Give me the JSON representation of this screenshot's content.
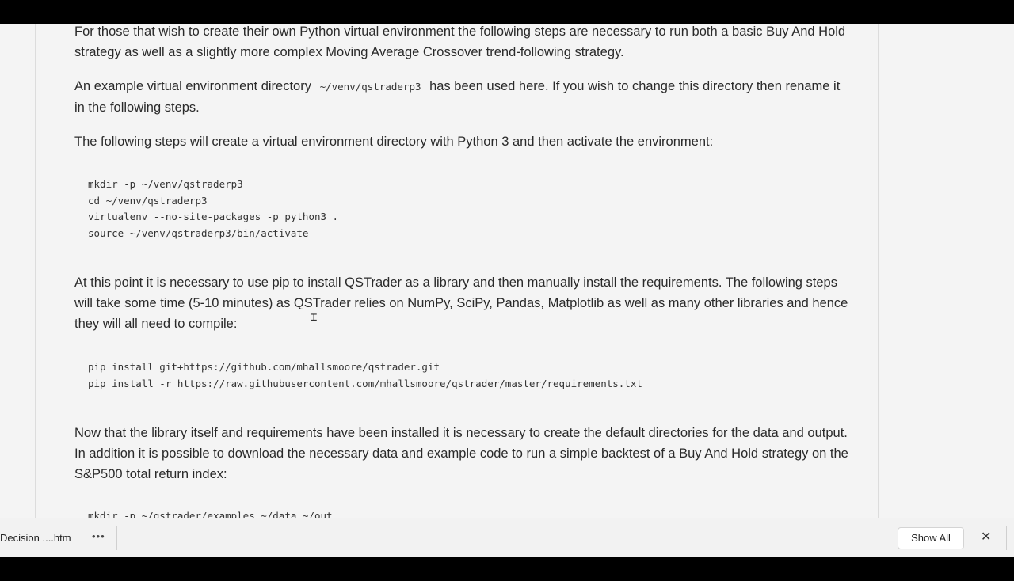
{
  "article": {
    "p1": "For those that wish to create their own Python virtual environment the following steps are necessary to run both a basic Buy And Hold strategy as well as a slightly more complex Moving Average Crossover trend-following strategy.",
    "p2_before": "An example virtual environment directory ",
    "p2_code": "~/venv/qstraderp3",
    "p2_after": " has been used here. If you wish to change this directory then rename it in the following steps.",
    "p3": "The following steps will create a virtual environment directory with Python 3 and then activate the environment:",
    "code1": "mkdir -p ~/venv/qstraderp3\ncd ~/venv/qstraderp3\nvirtualenv --no-site-packages -p python3 .\nsource ~/venv/qstraderp3/bin/activate",
    "p4": "At this point it is necessary to use pip to install QSTrader as a library and then manually install the requirements. The following steps will take some time (5-10 minutes) as QSTrader relies on NumPy, SciPy, Pandas, Matplotlib as well as many other libraries and hence they will all need to compile:",
    "code2": "pip install git+https://github.com/mhallsmoore/qstrader.git\npip install -r https://raw.githubusercontent.com/mhallsmoore/qstrader/master/requirements.txt",
    "p5": "Now that the library itself and requirements have been installed it is necessary to create the default directories for the data and output. In addition it is possible to download the necessary data and example code to run a simple backtest of a Buy And Hold strategy on the S&P500 total return index:",
    "code3": "mkdir -p ~/qstrader/examples ~/data ~/out"
  },
  "downloads_bar": {
    "item_label": "Decision ....htm",
    "more_label": "•••",
    "show_all_label": "Show All",
    "close_label": "✕"
  }
}
